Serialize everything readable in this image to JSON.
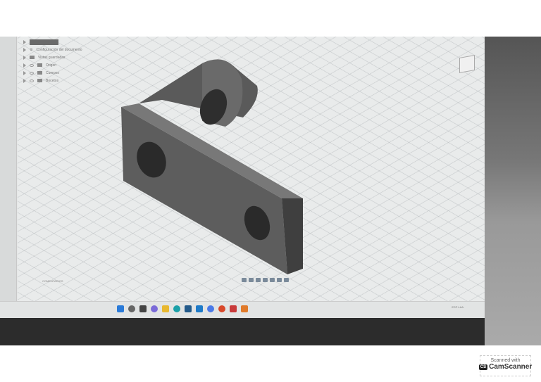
{
  "browser": {
    "items": [
      {
        "label": "Configuración del documento"
      },
      {
        "label": "Vistas guardadas"
      },
      {
        "label": "Origen"
      },
      {
        "label": "Cuerpos"
      },
      {
        "label": "Bocetos"
      }
    ]
  },
  "comments_label": "COMENTARIOS",
  "tray": {
    "lang": "ESP LAA"
  },
  "watermark": {
    "scanned": "Scanned with",
    "brand": "CamScanner",
    "logo": "CS"
  }
}
